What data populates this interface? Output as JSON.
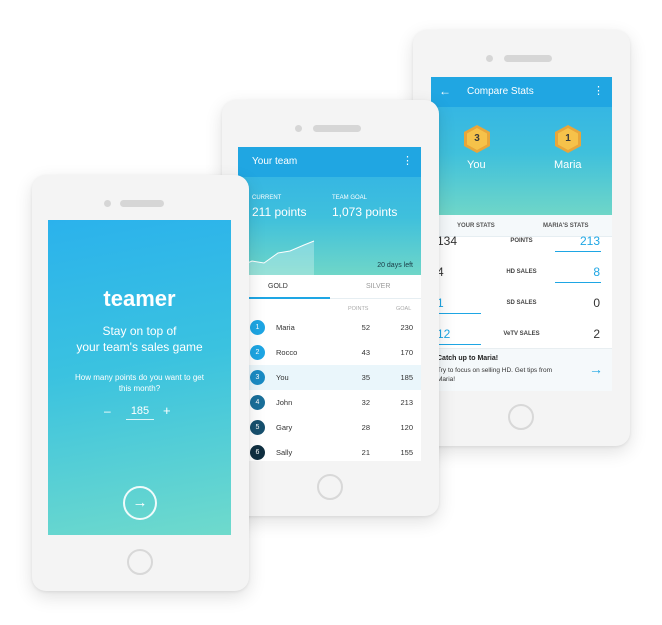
{
  "colors": {
    "accent": "#1ea6e4",
    "appbar": "#20a6e2",
    "badge_gold": "#f6c24a"
  },
  "compare": {
    "back_icon": "arrow-left-icon",
    "title": "Compare Stats",
    "menu_icon": "more-vertical-icon",
    "you": {
      "rank": "3",
      "name": "You"
    },
    "other": {
      "rank": "1",
      "name": "Maria"
    },
    "tabs": [
      "YOUR STATS",
      "MARIA'S STATS"
    ],
    "rows": [
      {
        "you": "134",
        "label": "POINTS",
        "them": "213"
      },
      {
        "you": "4",
        "label": "HD SALES",
        "them": "8"
      },
      {
        "you": "1",
        "label": "SD SALES",
        "them": "0"
      },
      {
        "you": "12",
        "label": "VeTV SALES",
        "them": "2"
      }
    ],
    "tip_title": "Catch up to Maria!",
    "tip_body": "Try to focus on selling HD. Get tips from Maria!"
  },
  "team": {
    "title": "Your team",
    "current_caption": "CURRENT",
    "current_value": "211 points",
    "goal_caption": "TEAM GOAL",
    "goal_value": "1,073 points",
    "days_left": "20 days left",
    "tabs": [
      "GOLD",
      "SILVER"
    ],
    "col_points": "POINTS",
    "col_goal": "GOAL",
    "rows": [
      {
        "rank": "1",
        "name": "Maria",
        "points": "52",
        "goal": "230",
        "color": "#1ea6e4"
      },
      {
        "rank": "2",
        "name": "Rocco",
        "points": "43",
        "goal": "170",
        "color": "#1ea6e4"
      },
      {
        "rank": "3",
        "name": "You",
        "points": "35",
        "goal": "185",
        "color": "#1a8bc4"
      },
      {
        "rank": "4",
        "name": "John",
        "points": "32",
        "goal": "213",
        "color": "#1a6f9a"
      },
      {
        "rank": "5",
        "name": "Gary",
        "points": "28",
        "goal": "120",
        "color": "#17506e"
      },
      {
        "rank": "6",
        "name": "Sally",
        "points": "21",
        "goal": "155",
        "color": "#0f2f40"
      }
    ]
  },
  "welcome": {
    "logo": "teamer",
    "tagline_1": "Stay on top of",
    "tagline_2": "your team's sales game",
    "question": "How many points do you want to get this month?",
    "minus": "–",
    "value": "185",
    "plus": "+",
    "go_icon": "arrow-right-circle-icon"
  }
}
